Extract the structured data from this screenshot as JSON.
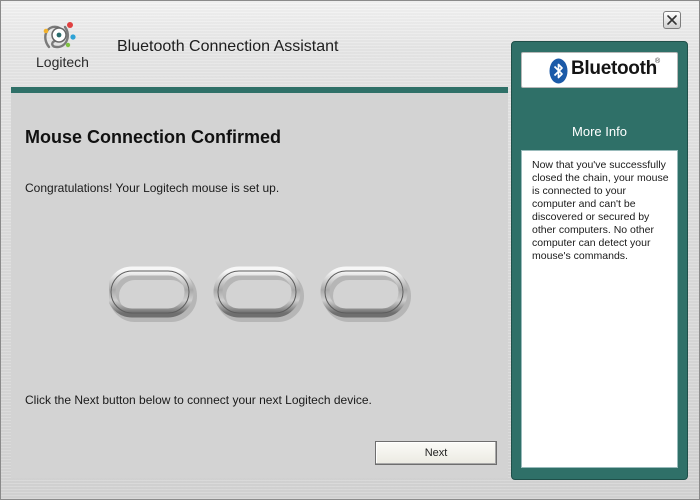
{
  "header": {
    "brand_name": "Logitech",
    "title": "Bluetooth Connection Assistant",
    "close_icon": "close-icon"
  },
  "main": {
    "heading": "Mouse Connection Confirmed",
    "message": "Congratulations! Your Logitech mouse is set up.",
    "illustration": "chain-links-illustration",
    "instruction": "Click the Next button below to connect your next Logitech device.",
    "next_label": "Next"
  },
  "sidebar": {
    "badge_text": "Bluetooth",
    "badge_tm": "®",
    "badge_icon": "bluetooth-icon",
    "more_info_title": "More Info",
    "info_text": "Now that you've successfully closed the chain, your mouse is connected to your computer and can't be discovered or secured by other computers. No other computer can detect your mouse's commands."
  },
  "colors": {
    "accent_teal": "#2f7068",
    "panel_gray": "#d3d3d3",
    "window_silver": "#dcdcdc"
  }
}
